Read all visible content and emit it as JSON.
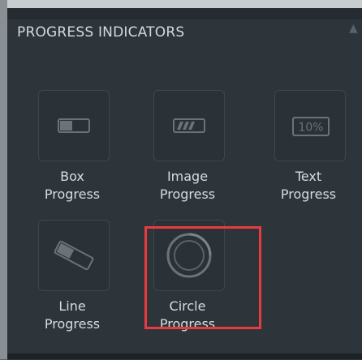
{
  "section": {
    "title": "PROGRESS INDICATORS"
  },
  "items": [
    {
      "label_line1": "Box",
      "label_line2": "Progress",
      "icon": "box-progress-icon"
    },
    {
      "label_line1": "Image",
      "label_line2": "Progress",
      "icon": "image-progress-icon"
    },
    {
      "label_line1": "Text",
      "label_line2": "Progress",
      "icon": "text-progress-icon",
      "icon_text": "10%"
    },
    {
      "label_line1": "Line",
      "label_line2": "Progress",
      "icon": "line-progress-icon"
    },
    {
      "label_line1": "Circle",
      "label_line2": "Progress",
      "icon": "circle-progress-icon"
    }
  ],
  "colors": {
    "panel": "#2d353a",
    "text": "#d8dcdf",
    "highlight": "#e83a3f"
  }
}
